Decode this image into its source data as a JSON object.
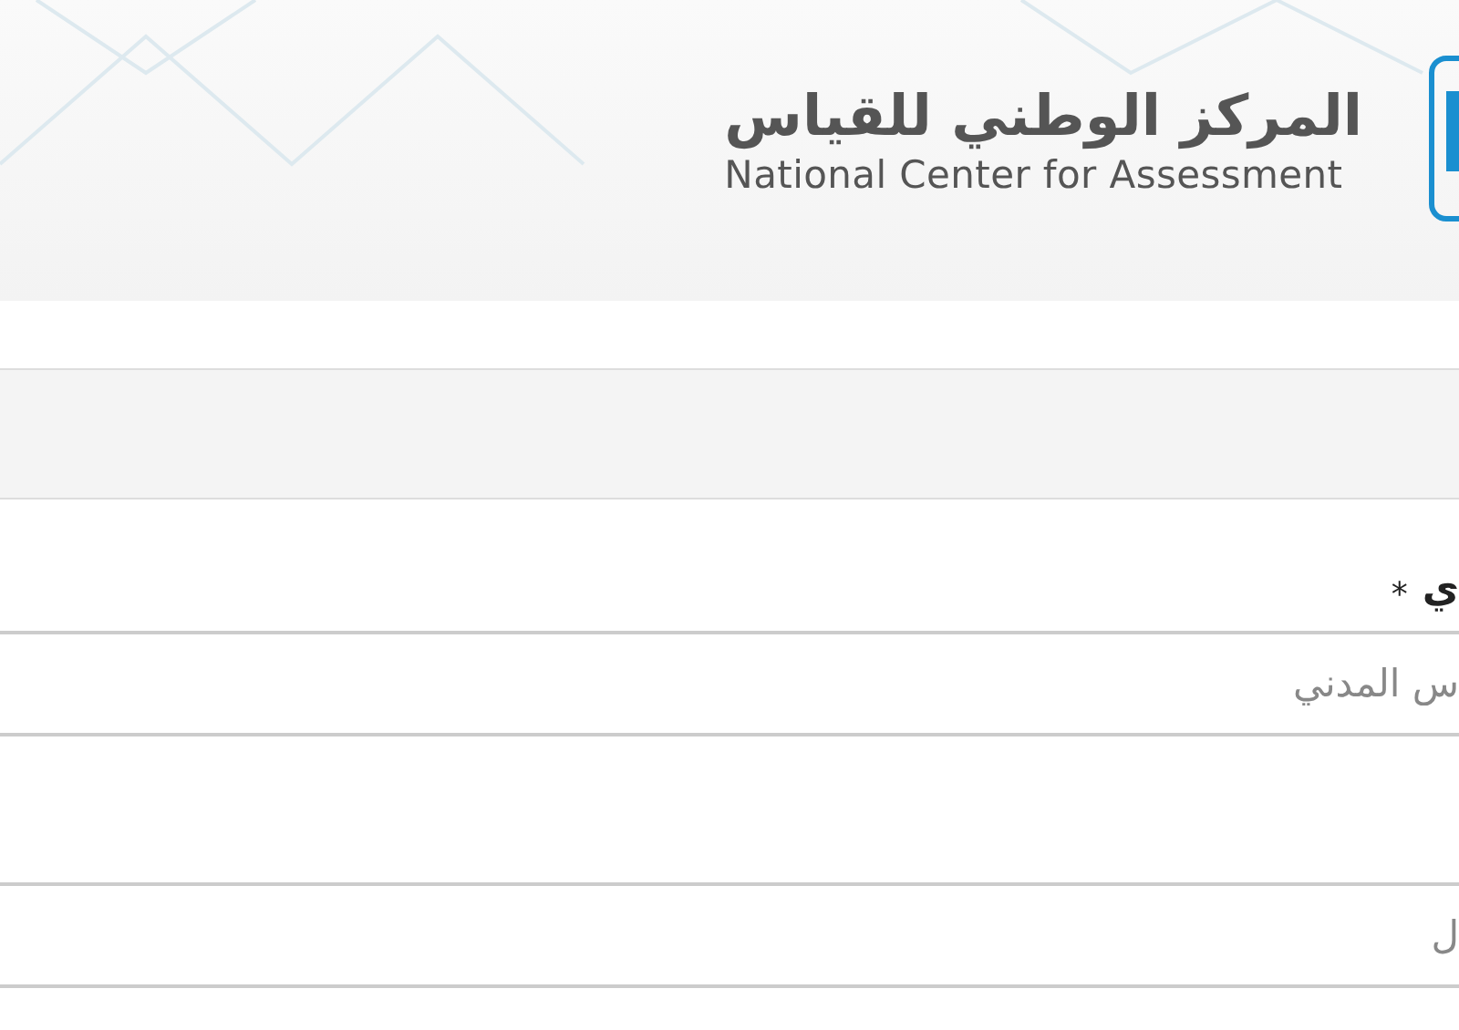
{
  "header": {
    "title_ar": "المركز الوطني للقياس",
    "title_en": "National Center for Assessment"
  },
  "form": {
    "label": "ي",
    "required_mark": "*",
    "fields": [
      {
        "placeholder": "س المدني"
      },
      {
        "placeholder": "ل"
      }
    ]
  }
}
